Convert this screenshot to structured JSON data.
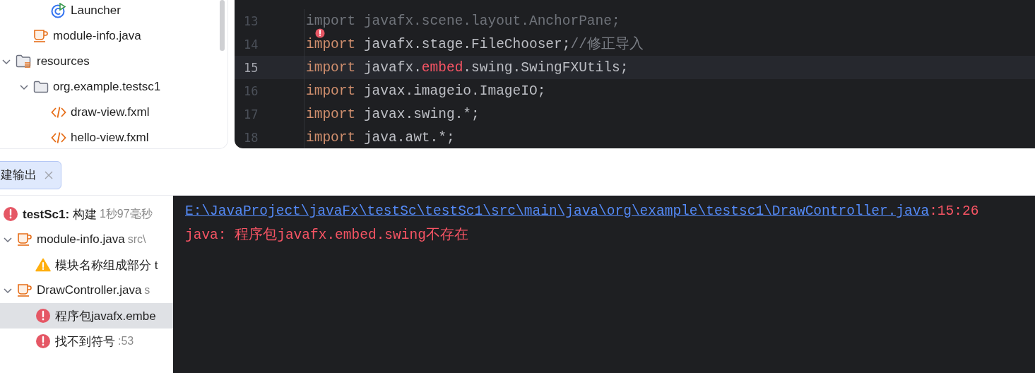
{
  "project_tree": {
    "items": [
      {
        "children": [
          {
            "children": [
              {
                "label": "Launcher",
                "kind": "run-class"
              }
            ]
          },
          {
            "label": "module-info.java",
            "kind": "java-file"
          }
        ]
      },
      {
        "label": "resources",
        "kind": "resource-folder",
        "expanded": true,
        "children": [
          {
            "label": "org.example.testsc1",
            "kind": "folder",
            "expanded": true,
            "children": [
              {
                "label": "draw-view.fxml",
                "kind": "fxml"
              },
              {
                "label": "hello-view.fxml",
                "kind": "fxml"
              }
            ]
          }
        ]
      }
    ]
  },
  "editor": {
    "lines": [
      {
        "number": "13",
        "current": false,
        "error_mark": false,
        "segments": [
          {
            "kind": "dim",
            "text": "import javafx.scene.layout.AnchorPane;"
          }
        ]
      },
      {
        "number": "14",
        "current": false,
        "error_mark": true,
        "segments": [
          {
            "kind": "keyword",
            "text": "import"
          },
          {
            "kind": "plain",
            "text": " javafx.stage.FileChooser;"
          },
          {
            "kind": "comment",
            "text": "//修正导入"
          }
        ]
      },
      {
        "number": "15",
        "current": true,
        "error_mark": false,
        "segments": [
          {
            "kind": "keyword",
            "text": "import"
          },
          {
            "kind": "plain",
            "text": " javafx."
          },
          {
            "kind": "error",
            "text": "embed"
          },
          {
            "kind": "plain",
            "text": ".swing.SwingFXUtils;"
          }
        ]
      },
      {
        "number": "16",
        "current": false,
        "error_mark": false,
        "segments": [
          {
            "kind": "keyword",
            "text": "import"
          },
          {
            "kind": "plain",
            "text": " javax.imageio.ImageIO;"
          }
        ]
      },
      {
        "number": "17",
        "current": false,
        "error_mark": false,
        "segments": [
          {
            "kind": "keyword",
            "text": "import"
          },
          {
            "kind": "plain",
            "text": " javax.swing.*;"
          }
        ]
      },
      {
        "number": "18",
        "current": false,
        "error_mark": false,
        "segments": [
          {
            "kind": "keyword",
            "text": "import"
          },
          {
            "kind": "plain",
            "text": " java.awt.*;"
          }
        ]
      }
    ]
  },
  "tool_tabs": [
    {
      "label": "建输出",
      "selected": true
    }
  ],
  "build_tree": {
    "items": [
      {
        "label": "**testSc1:** 构建",
        "hint": "1秒97毫秒",
        "kind": "error",
        "selected": false,
        "children": [
          {
            "label": "module-info.java",
            "hint": "src\\",
            "kind": "java-file",
            "expanded": true,
            "selected": false,
            "children": [
              {
                "label": "模块名称组成部分 t",
                "kind": "warning",
                "selected": false
              }
            ]
          },
          {
            "label": "DrawController.java",
            "hint": "s",
            "kind": "java-file",
            "expanded": true,
            "selected": false,
            "children": [
              {
                "label": "程序包javafx.embe",
                "kind": "error",
                "selected": true
              },
              {
                "label": "找不到符号",
                "hint": ":53",
                "kind": "error",
                "selected": false
              }
            ]
          }
        ]
      }
    ]
  },
  "console": {
    "lines": [
      {
        "link": "E:\\JavaProject\\javaFx\\testSc\\testSc1\\src\\main\\java\\org\\example\\testsc1\\DrawController.java",
        "suffix": ":15:26"
      },
      {
        "text": "java: 程序包javafx.embed.swing不存在"
      }
    ]
  }
}
